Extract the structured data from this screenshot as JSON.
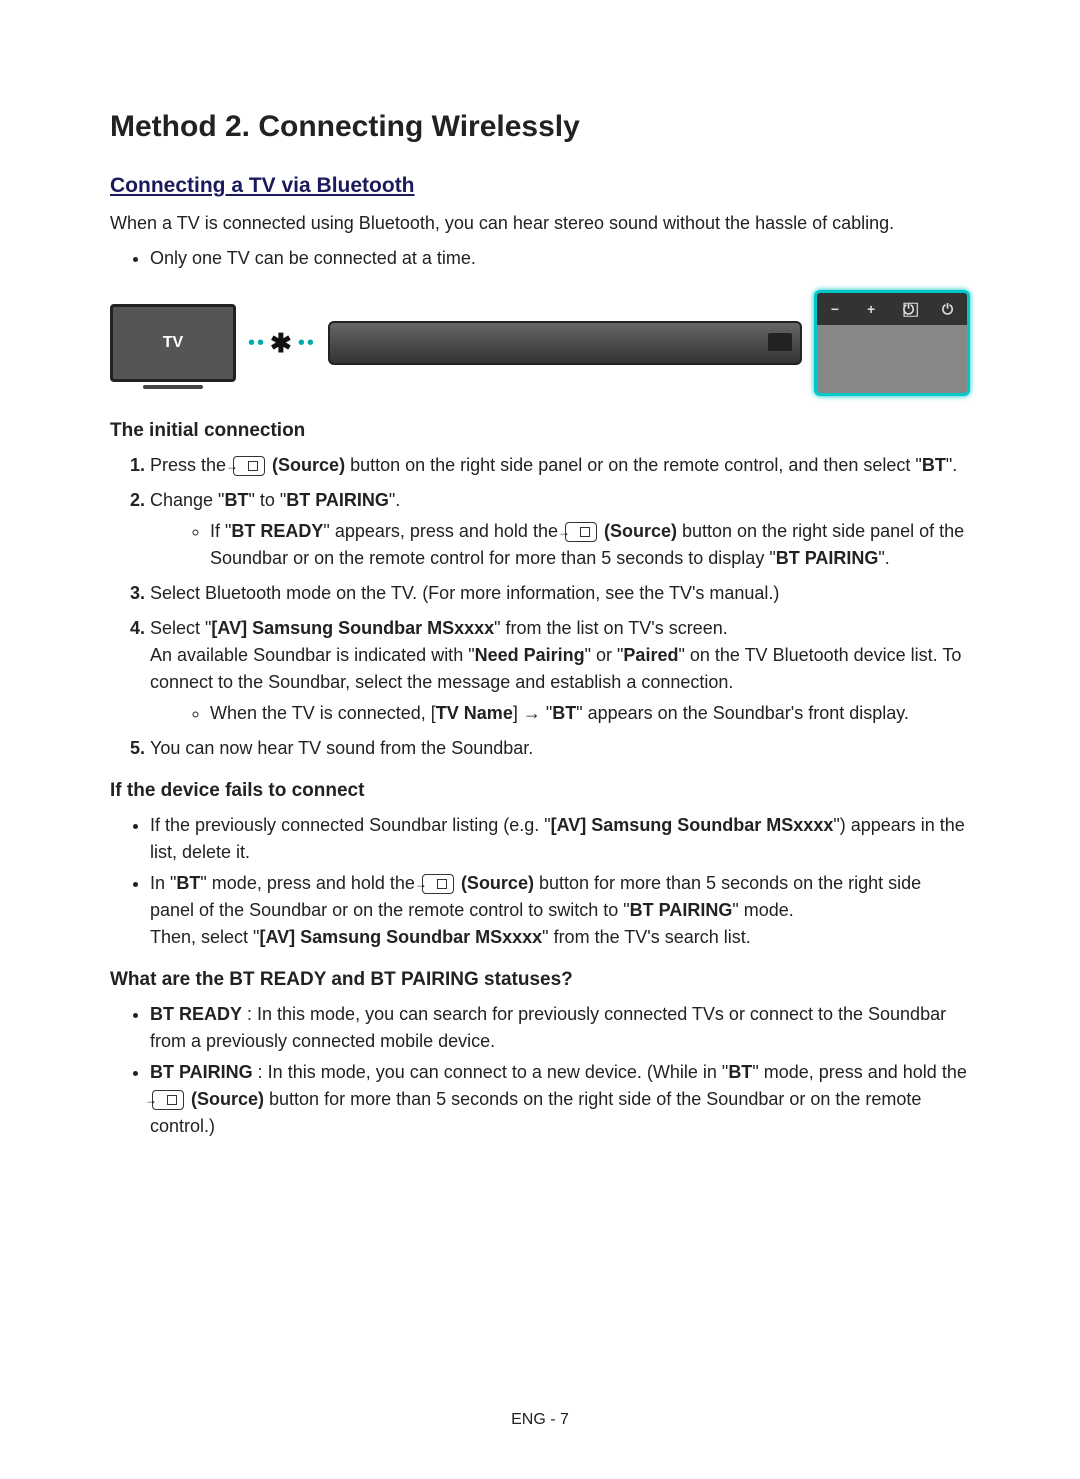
{
  "title": "Method 2. Connecting Wirelessly",
  "section1_title": "Connecting a TV via Bluetooth",
  "intro": "When a TV is connected using Bluetooth, you can hear stereo sound without the hassle of cabling.",
  "intro_bullet": "Only one TV can be connected at a time.",
  "diagram": {
    "tv_label": "TV"
  },
  "initial_heading": "The initial connection",
  "steps": {
    "s1_a": "Press the ",
    "s1_source": " (Source)",
    "s1_b": " button on the right side panel or on the remote control, and then select \"",
    "s1_bt": "BT",
    "s1_c": "\".",
    "s2_a": "Change \"",
    "s2_bt1": "BT",
    "s2_b": "\" to \"",
    "s2_bt2": "BT PAIRING",
    "s2_c": "\".",
    "s2_sub_a": "If \"",
    "s2_sub_ready": "BT READY",
    "s2_sub_b": "\" appears, press and hold the ",
    "s2_sub_source": " (Source)",
    "s2_sub_c": " button on the right side panel of the Soundbar or on the remote control for more than 5 seconds to display \"",
    "s2_sub_pair": "BT PAIRING",
    "s2_sub_d": "\".",
    "s3": "Select Bluetooth mode on the TV. (For more information, see the TV's manual.)",
    "s4_a": "Select \"",
    "s4_name": "[AV] Samsung Soundbar MSxxxx",
    "s4_b": "\" from the list on TV's screen.",
    "s4_line2_a": "An available Soundbar is indicated with \"",
    "s4_np": "Need Pairing",
    "s4_line2_b": "\" or \"",
    "s4_paired": "Paired",
    "s4_line2_c": "\" on the TV Bluetooth device list. To connect to the Soundbar, select the message and establish a connection.",
    "s4_sub_a": "When the TV is connected, [",
    "s4_tvname": "TV Name",
    "s4_sub_b": "] → \"",
    "s4_bt": "BT",
    "s4_sub_c": "\" appears on the Soundbar's front display.",
    "s5": "You can now hear TV sound from the Soundbar."
  },
  "fail_heading": "If the device fails to connect",
  "fail": {
    "b1_a": "If the previously connected Soundbar listing (e.g. \"",
    "b1_name": "[AV] Samsung Soundbar MSxxxx",
    "b1_b": "\") appears in the list, delete it.",
    "b2_a": "In \"",
    "b2_bt": "BT",
    "b2_b": "\" mode, press and hold the ",
    "b2_source": " (Source)",
    "b2_c": " button for more than 5 seconds on the right side panel of the Soundbar or on the remote control to switch to \"",
    "b2_pair": "BT PAIRING",
    "b2_d": "\" mode.",
    "b2_line2_a": "Then, select \"",
    "b2_line2_name": "[AV] Samsung Soundbar MSxxxx",
    "b2_line2_b": "\" from the TV's search list."
  },
  "status_heading": "What are the BT READY and BT PAIRING statuses?",
  "status": {
    "r_label": "BT READY",
    "r_text": " : In this mode, you can search for previously connected TVs or connect to the Soundbar from a previously connected mobile device.",
    "p_label": "BT PAIRING",
    "p_a": " : In this mode, you can connect to a new device. (While in \"",
    "p_bt": "BT",
    "p_b": "\" mode, press and hold the ",
    "p_source": " (Source)",
    "p_c": " button for more than 5 seconds on the right side of the Soundbar or on the remote control.)"
  },
  "footer": "ENG - 7"
}
